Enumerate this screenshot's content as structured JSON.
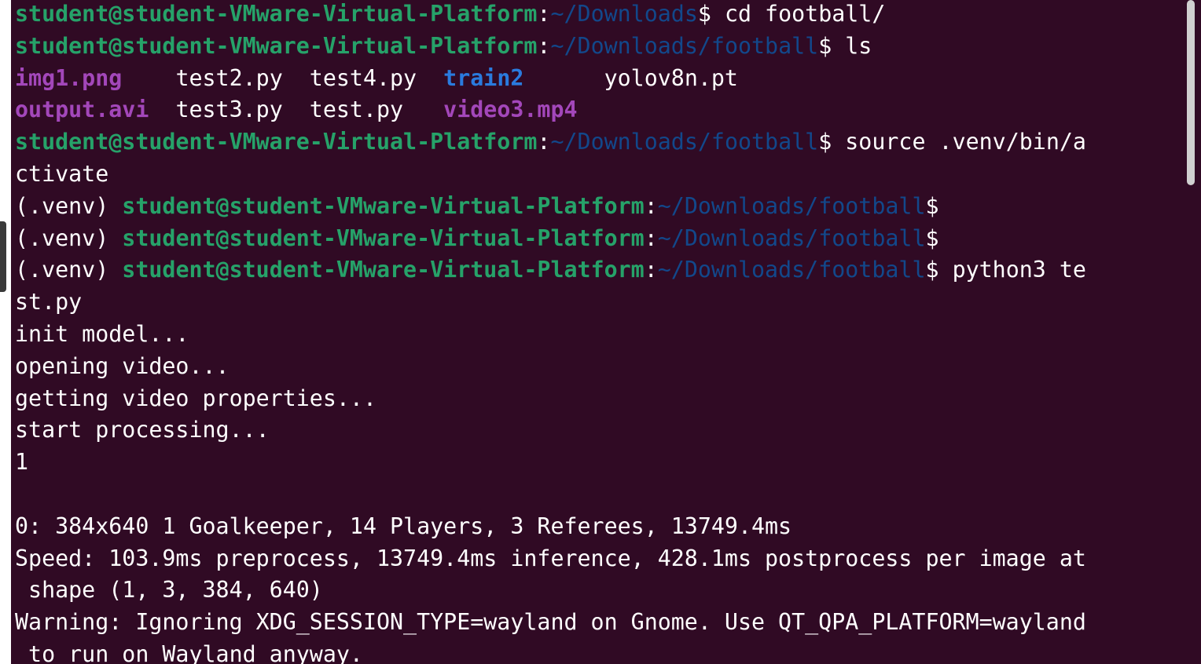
{
  "terminal": {
    "lines": [
      [
        {
          "t": "student@student-VMware-Virtual-Platform",
          "c": "prompt-user",
          "n": "prompt-user-host"
        },
        {
          "t": ":",
          "c": "",
          "n": "prompt-separator"
        },
        {
          "t": "~/Downloads",
          "c": "prompt-path",
          "n": "prompt-path"
        },
        {
          "t": "$ cd football/",
          "c": "",
          "n": "command-text"
        }
      ],
      [
        {
          "t": "student@student-VMware-Virtual-Platform",
          "c": "prompt-user",
          "n": "prompt-user-host"
        },
        {
          "t": ":",
          "c": "",
          "n": "prompt-separator"
        },
        {
          "t": "~/Downloads/football",
          "c": "prompt-path",
          "n": "prompt-path"
        },
        {
          "t": "$ ls",
          "c": "",
          "n": "command-text"
        }
      ],
      [
        {
          "t": "img1.png",
          "c": "img-ls",
          "n": "ls-entry-image"
        },
        {
          "t": "    test2.py  test4.py  ",
          "c": "",
          "n": "ls-entry-file"
        },
        {
          "t": "train2",
          "c": "dir-ls",
          "n": "ls-entry-directory"
        },
        {
          "t": "      yolov8n.pt",
          "c": "",
          "n": "ls-entry-file"
        }
      ],
      [
        {
          "t": "output.avi",
          "c": "img-ls",
          "n": "ls-entry-media"
        },
        {
          "t": "  test3.py  test.py   ",
          "c": "",
          "n": "ls-entry-file"
        },
        {
          "t": "video3.mp4",
          "c": "img-ls",
          "n": "ls-entry-media"
        }
      ],
      [
        {
          "t": "student@student-VMware-Virtual-Platform",
          "c": "prompt-user",
          "n": "prompt-user-host"
        },
        {
          "t": ":",
          "c": "",
          "n": "prompt-separator"
        },
        {
          "t": "~/Downloads/football",
          "c": "prompt-path",
          "n": "prompt-path"
        },
        {
          "t": "$ source .venv/bin/a",
          "c": "",
          "n": "command-text"
        }
      ],
      [
        {
          "t": "ctivate",
          "c": "",
          "n": "command-text-wrapped"
        }
      ],
      [
        {
          "t": "(.venv) ",
          "c": "",
          "n": "venv-indicator"
        },
        {
          "t": "student@student-VMware-Virtual-Platform",
          "c": "prompt-user",
          "n": "prompt-user-host"
        },
        {
          "t": ":",
          "c": "",
          "n": "prompt-separator"
        },
        {
          "t": "~/Downloads/football",
          "c": "prompt-path",
          "n": "prompt-path"
        },
        {
          "t": "$",
          "c": "",
          "n": "prompt-symbol"
        }
      ],
      [
        {
          "t": "(.venv) ",
          "c": "",
          "n": "venv-indicator"
        },
        {
          "t": "student@student-VMware-Virtual-Platform",
          "c": "prompt-user",
          "n": "prompt-user-host"
        },
        {
          "t": ":",
          "c": "",
          "n": "prompt-separator"
        },
        {
          "t": "~/Downloads/football",
          "c": "prompt-path",
          "n": "prompt-path"
        },
        {
          "t": "$",
          "c": "",
          "n": "prompt-symbol"
        }
      ],
      [
        {
          "t": "(.venv) ",
          "c": "",
          "n": "venv-indicator"
        },
        {
          "t": "student@student-VMware-Virtual-Platform",
          "c": "prompt-user",
          "n": "prompt-user-host"
        },
        {
          "t": ":",
          "c": "",
          "n": "prompt-separator"
        },
        {
          "t": "~/Downloads/football",
          "c": "prompt-path",
          "n": "prompt-path"
        },
        {
          "t": "$ python3 te",
          "c": "",
          "n": "command-text"
        }
      ],
      [
        {
          "t": "st.py",
          "c": "",
          "n": "command-text-wrapped"
        }
      ],
      [
        {
          "t": "init model...",
          "c": "",
          "n": "output-text"
        }
      ],
      [
        {
          "t": "opening video...",
          "c": "",
          "n": "output-text"
        }
      ],
      [
        {
          "t": "getting video properties...",
          "c": "",
          "n": "output-text"
        }
      ],
      [
        {
          "t": "start processing...",
          "c": "",
          "n": "output-text"
        }
      ],
      [
        {
          "t": "1",
          "c": "",
          "n": "output-text"
        }
      ],
      [],
      [
        {
          "t": "0: 384x640 1 Goalkeeper, 14 Players, 3 Referees, 13749.4ms",
          "c": "",
          "n": "output-text"
        }
      ],
      [
        {
          "t": "Speed: 103.9ms preprocess, 13749.4ms inference, 428.1ms postprocess per image at",
          "c": "",
          "n": "output-text"
        }
      ],
      [
        {
          "t": " shape (1, 3, 384, 640)",
          "c": "",
          "n": "output-text"
        }
      ],
      [
        {
          "t": "Warning: Ignoring XDG_SESSION_TYPE=wayland on Gnome. Use QT_QPA_PLATFORM=wayland",
          "c": "",
          "n": "warning-text"
        }
      ],
      [
        {
          "t": " to run on Wayland anyway.",
          "c": "",
          "n": "warning-text"
        }
      ]
    ]
  },
  "colors": {
    "background": "#300a24",
    "prompt_user": "#26a269",
    "prompt_path": "#12488b",
    "directory": "#2a7bde",
    "media": "#a347ba",
    "text": "#ffffff"
  }
}
